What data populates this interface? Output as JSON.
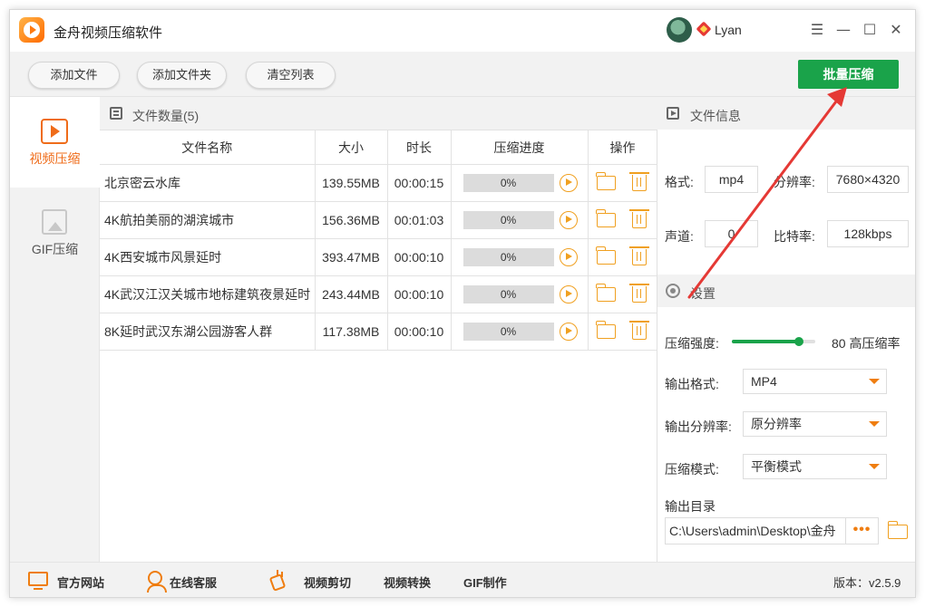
{
  "app": {
    "title": "金舟视频压缩软件",
    "username": "Lyan"
  },
  "window_controls": {
    "menu": "☰",
    "minimize": "—",
    "maximize": "☐",
    "close": "✕"
  },
  "toolbar": {
    "add_file": "添加文件",
    "add_folder": "添加文件夹",
    "clear_list": "清空列表",
    "batch_compress": "批量压缩"
  },
  "sidebar": {
    "items": [
      {
        "label": "视频压缩",
        "icon": "video-play-icon",
        "active": true
      },
      {
        "label": "GIF压缩",
        "icon": "image-icon",
        "active": false
      }
    ]
  },
  "file_list": {
    "title": "文件数量(5)",
    "columns": [
      "文件名称",
      "大小",
      "时长",
      "压缩进度",
      "操作"
    ],
    "rows": [
      {
        "name": "北京密云水库",
        "size": "139.55MB",
        "duration": "00:00:15",
        "progress": "0%"
      },
      {
        "name": "4K航拍美丽的湖滨城市",
        "size": "156.36MB",
        "duration": "00:01:03",
        "progress": "0%"
      },
      {
        "name": "4K西安城市风景延时",
        "size": "393.47MB",
        "duration": "00:00:10",
        "progress": "0%"
      },
      {
        "name": "4K武汉江汉关城市地标建筑夜景延时",
        "size": "243.44MB",
        "duration": "00:00:10",
        "progress": "0%"
      },
      {
        "name": "8K延时武汉东湖公园游客人群",
        "size": "117.38MB",
        "duration": "00:00:10",
        "progress": "0%"
      }
    ]
  },
  "file_info": {
    "title": "文件信息",
    "format_label": "格式:",
    "format": "mp4",
    "resolution_label": "分辨率:",
    "resolution": "7680×4320",
    "channel_label": "声道:",
    "channel": "0",
    "bitrate_label": "比特率:",
    "bitrate": "128kbps"
  },
  "settings": {
    "title": "设置",
    "strength_label": "压缩强度:",
    "strength_value": 80,
    "strength_text": "80 高压缩率",
    "format_label": "输出格式:",
    "format": "MP4",
    "resolution_label": "输出分辨率:",
    "resolution": "原分辨率",
    "mode_label": "压缩模式:",
    "mode": "平衡模式",
    "dir_label": "输出目录",
    "dir_path": "C:\\Users\\admin\\Desktop\\金舟",
    "more": "•••"
  },
  "footer": {
    "website": "官方网站",
    "service": "在线客服",
    "video_cut": "视频剪切",
    "video_convert": "视频转换",
    "gif_make": "GIF制作",
    "version": "版本：v2.5.9"
  },
  "colors": {
    "accent": "#ef6c1a",
    "green": "#1aa34a",
    "annotation": "#e53935"
  }
}
